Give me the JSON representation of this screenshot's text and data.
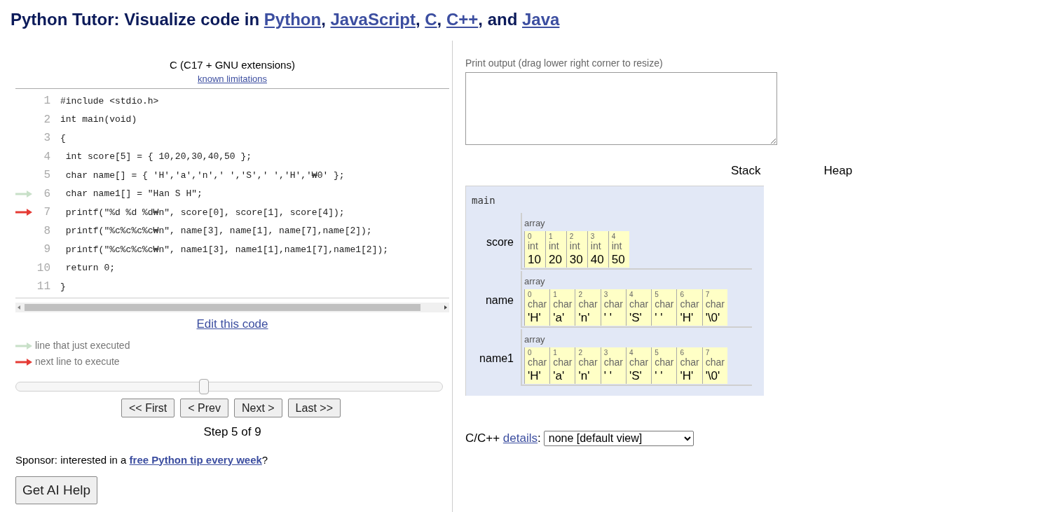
{
  "title": [
    {
      "kind": "text",
      "text": "Python Tutor: Visualize code in "
    },
    {
      "kind": "link",
      "text": "Python"
    },
    {
      "kind": "text",
      "text": ", "
    },
    {
      "kind": "link",
      "text": "JavaScript"
    },
    {
      "kind": "text",
      "text": ", "
    },
    {
      "kind": "link",
      "text": "C"
    },
    {
      "kind": "text",
      "text": ", "
    },
    {
      "kind": "link",
      "text": "C++"
    },
    {
      "kind": "text",
      "text": ", and "
    },
    {
      "kind": "link",
      "text": "Java"
    }
  ],
  "editor": {
    "language": "C (C17 + GNU extensions)",
    "limitations_link": "known limitations",
    "lines": [
      {
        "number": "1",
        "code": "#include <stdio.h>",
        "just_executed": false,
        "next": false
      },
      {
        "number": "2",
        "code": "int main(void)",
        "just_executed": false,
        "next": false
      },
      {
        "number": "3",
        "code": "{",
        "just_executed": false,
        "next": false
      },
      {
        "number": "4",
        "code": " int score[5] = { 10,20,30,40,50 };",
        "just_executed": false,
        "next": false
      },
      {
        "number": "5",
        "code": " char name[] = { 'H','a','n',' ','S',' ','H','₩0' };",
        "just_executed": false,
        "next": false
      },
      {
        "number": "6",
        "code": " char name1[] = \"Han S H\";",
        "just_executed": true,
        "next": false
      },
      {
        "number": "7",
        "code": " printf(\"%d %d %d₩n\", score[0], score[1], score[4]);",
        "just_executed": false,
        "next": true
      },
      {
        "number": "8",
        "code": " printf(\"%c%c%c%c₩n\", name[3], name[1], name[7],name[2]);",
        "just_executed": false,
        "next": false
      },
      {
        "number": "9",
        "code": " printf(\"%c%c%c%c₩n\", name1[3], name1[1],name1[7],name1[2]);",
        "just_executed": false,
        "next": false
      },
      {
        "number": "10",
        "code": " return 0;",
        "just_executed": false,
        "next": false
      },
      {
        "number": "11",
        "code": "}",
        "just_executed": false,
        "next": false
      }
    ],
    "edit_link": "Edit this code",
    "legend": [
      "line that just executed",
      "next line to execute"
    ],
    "slider": {
      "level": 0.44
    },
    "buttons": [
      "<< First",
      "< Prev",
      "Next >",
      "Last >>"
    ],
    "step": "Step 5 of 9"
  },
  "sponsor": [
    {
      "kind": "text",
      "text": "Sponsor: interested in a "
    },
    {
      "kind": "link",
      "text": "free Python tip every week"
    },
    {
      "kind": "text",
      "text": "?"
    }
  ],
  "ai_button": "Get AI Help",
  "output": {
    "label": "Print output (drag lower right corner to resize)"
  },
  "headers": [
    "Stack",
    "Heap"
  ],
  "frame": {
    "name": "main",
    "vars": [
      {
        "name": "score",
        "label": "array",
        "elements": [
          {
            "index": "0",
            "type": "int",
            "value": "10"
          },
          {
            "index": "1",
            "type": "int",
            "value": "20"
          },
          {
            "index": "2",
            "type": "int",
            "value": "30"
          },
          {
            "index": "3",
            "type": "int",
            "value": "40"
          },
          {
            "index": "4",
            "type": "int",
            "value": "50"
          }
        ]
      },
      {
        "name": "name",
        "label": "array",
        "elements": [
          {
            "index": "0",
            "type": "char",
            "value": "'H'"
          },
          {
            "index": "1",
            "type": "char",
            "value": "'a'"
          },
          {
            "index": "2",
            "type": "char",
            "value": "'n'"
          },
          {
            "index": "3",
            "type": "char",
            "value": "' '"
          },
          {
            "index": "4",
            "type": "char",
            "value": "'S'"
          },
          {
            "index": "5",
            "type": "char",
            "value": "' '"
          },
          {
            "index": "6",
            "type": "char",
            "value": "'H'"
          },
          {
            "index": "7",
            "type": "char",
            "value": "'\\0'"
          }
        ]
      },
      {
        "name": "name1",
        "label": "array",
        "elements": [
          {
            "index": "0",
            "type": "char",
            "value": "'H'"
          },
          {
            "index": "1",
            "type": "char",
            "value": "'a'"
          },
          {
            "index": "2",
            "type": "char",
            "value": "'n'"
          },
          {
            "index": "3",
            "type": "char",
            "value": "' '"
          },
          {
            "index": "4",
            "type": "char",
            "value": "'S'"
          },
          {
            "index": "5",
            "type": "char",
            "value": "' '"
          },
          {
            "index": "6",
            "type": "char",
            "value": "'H'"
          },
          {
            "index": "7",
            "type": "char",
            "value": "'\\0'"
          }
        ]
      }
    ]
  },
  "details": {
    "prefix": "C/C++ ",
    "link": "details",
    "suffix": ":",
    "value": "none [default view]"
  }
}
